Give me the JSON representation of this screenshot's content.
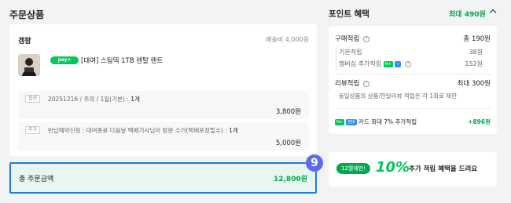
{
  "order": {
    "title": "주문상품",
    "seller": "겜팜",
    "shipping": "배송비 4,000원",
    "product": {
      "pay_badge": "pay+",
      "name": "[대여] 스팀덱 1TB 렌탈 렌트"
    },
    "options": [
      {
        "tag": "옵션",
        "text": "20251216 / 주의 / 1일(기본) : ",
        "qty": "1개",
        "price": "3,800원"
      },
      {
        "tag": "추가",
        "text": "반납예약신청 : 대여종료 다음날 택배기사님이 방문 수거(택배포장필수) : ",
        "qty": "1개",
        "price": "5,000원"
      }
    ],
    "total_label": "총 주문금액",
    "total_value": "12,800원",
    "overlay_badge": "9"
  },
  "points": {
    "title": "포인트 혜택",
    "summary": "최대 490원",
    "purchase": {
      "label": "구매적립",
      "value": "총 190원",
      "basic_label": "기본적립",
      "basic_value": "38원",
      "member_label": "멤버십 추가적립",
      "member_badges": [
        "N+",
        "✓"
      ],
      "member_value": "152원"
    },
    "review": {
      "label": "리뷰적립",
      "value": "최대 300원",
      "note": "· 동일상품의 상품/한달리뷰 적립은 각 1회로 제한"
    },
    "card": {
      "badges": [
        "N+",
        "현대"
      ],
      "label": "카드 최대 7% 추가적립",
      "value": "+896원"
    }
  },
  "banner": {
    "pill": "12월에만!",
    "big": "10%",
    "text": "추가 적립 혜택을 드려요"
  },
  "colors": {
    "green": "#03c75a",
    "dark_green": "#03a94f",
    "highlight_border": "#1d7ed6",
    "badge_purple": "#5a6bf0"
  }
}
